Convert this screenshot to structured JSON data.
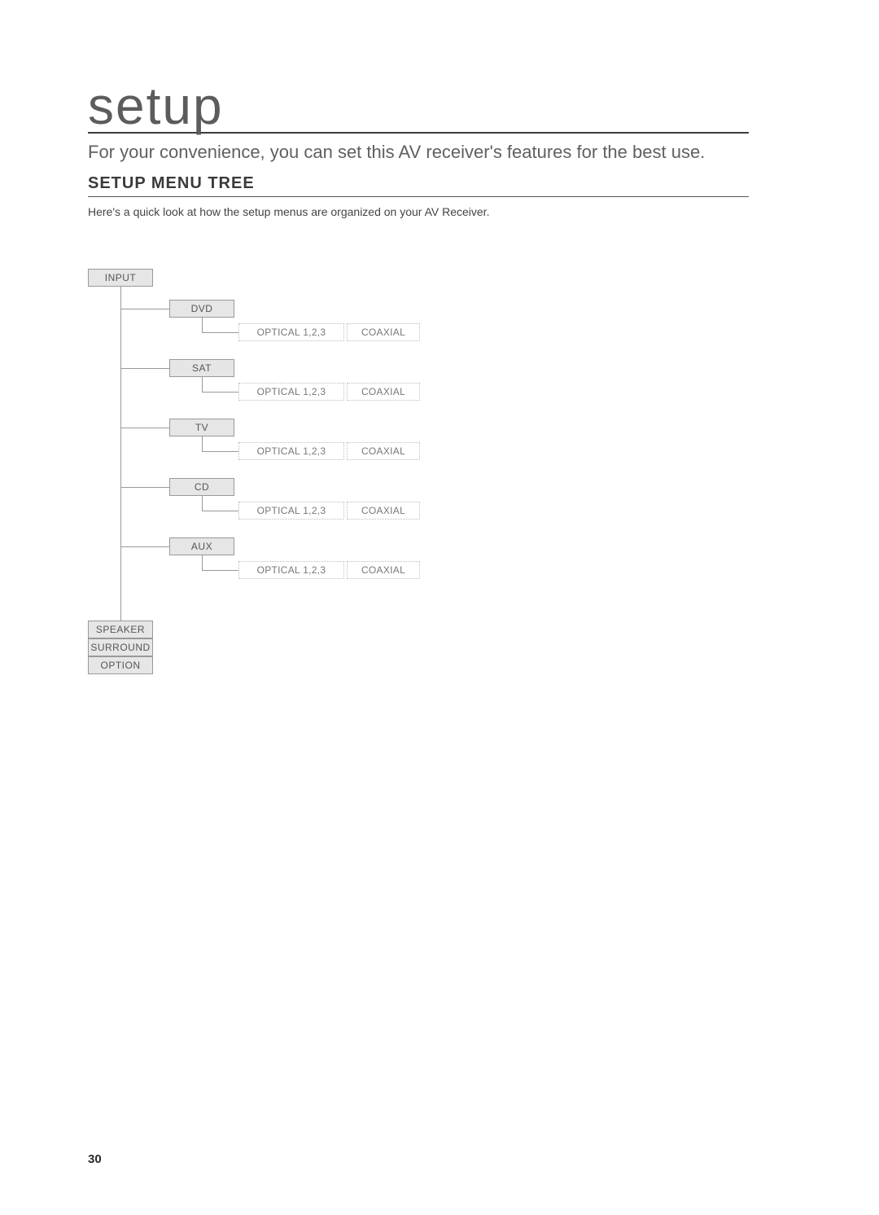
{
  "page": {
    "title": "setup",
    "intro": "For your convenience, you can set this AV receiver's features for the best use.",
    "section_heading": "SETUP MENU TREE",
    "section_sub": "Here's a quick look at how the setup menus are organized on your AV Receiver.",
    "page_number": "30"
  },
  "tree": {
    "root": "INPUT",
    "inputs": [
      {
        "label": "DVD",
        "optical": "OPTICAL 1,2,3",
        "coaxial": "COAXIAL"
      },
      {
        "label": "SAT",
        "optical": "OPTICAL 1,2,3",
        "coaxial": "COAXIAL"
      },
      {
        "label": "TV",
        "optical": "OPTICAL 1,2,3",
        "coaxial": "COAXIAL"
      },
      {
        "label": "CD",
        "optical": "OPTICAL 1,2,3",
        "coaxial": "COAXIAL"
      },
      {
        "label": "AUX",
        "optical": "OPTICAL 1,2,3",
        "coaxial": "COAXIAL"
      }
    ],
    "siblings": [
      "SPEAKER",
      "SURROUND",
      "OPTION"
    ]
  }
}
